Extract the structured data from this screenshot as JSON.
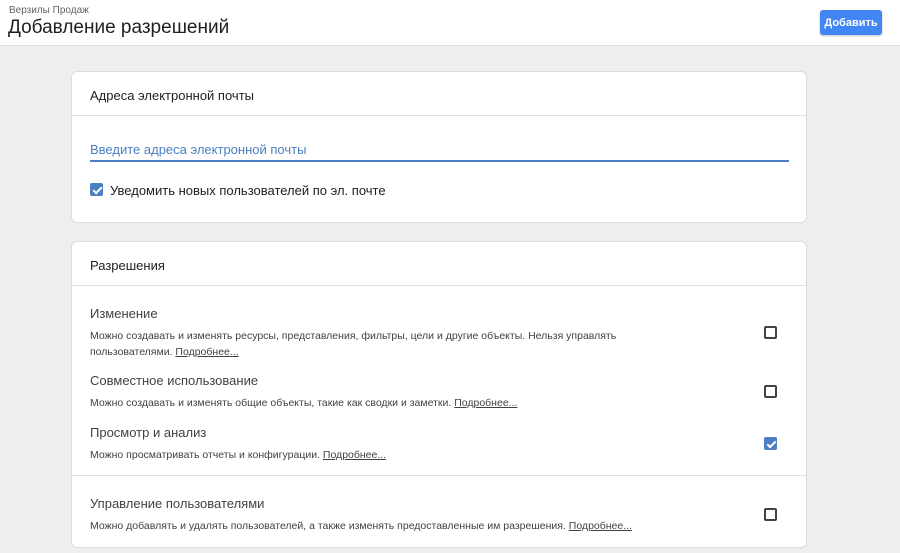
{
  "header": {
    "breadcrumb": "Верзилы Продаж",
    "title": "Добавление разрешений",
    "add_button": "Добавить"
  },
  "email_section": {
    "title": "Адреса электронной почты",
    "input_value": "",
    "input_placeholder": "Введите адреса электронной почты",
    "notify_label": "Уведомить новых пользователей по эл. почте",
    "notify_checked": true
  },
  "permissions_section": {
    "title": "Разрешения",
    "items": [
      {
        "title": "Изменение",
        "description": "Можно создавать и изменять ресурсы, представления, фильтры, цели и другие объекты. Нельзя управлять пользователями.",
        "more_link": "Подробнее...",
        "checked": false
      },
      {
        "title": "Совместное использование",
        "description": "Можно создавать и изменять общие объекты, такие как сводки и заметки.",
        "more_link": "Подробнее...",
        "checked": false
      },
      {
        "title": "Просмотр и анализ",
        "description": "Можно просматривать отчеты и конфигурации.",
        "more_link": "Подробнее...",
        "checked": true
      },
      {
        "title": "Управление пользователями",
        "description": "Можно добавлять и удалять пользователей, а также изменять предоставленные им разрешения.",
        "more_link": "Подробнее...",
        "checked": false
      }
    ]
  },
  "colors": {
    "accent": "#4285f4",
    "input_line": "#4a7fc1",
    "background": "#eeeeee"
  }
}
